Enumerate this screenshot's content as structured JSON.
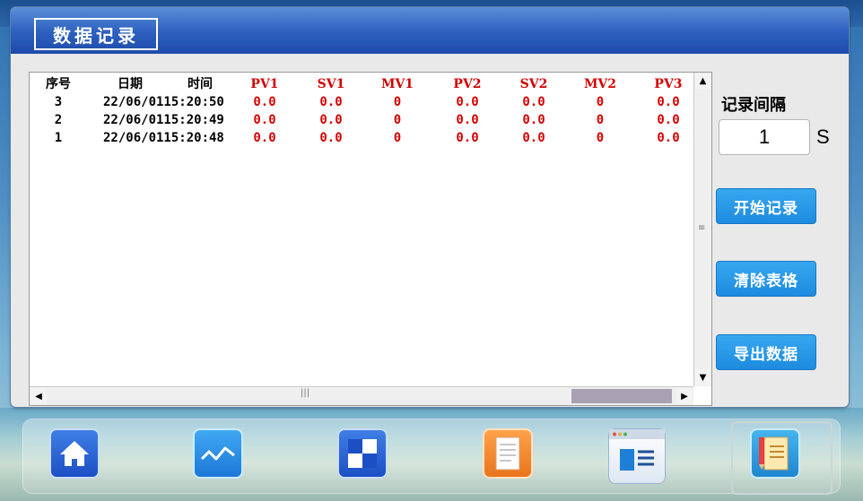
{
  "window": {
    "title": "数据记录"
  },
  "table": {
    "headers": {
      "seq": "序号",
      "date": "日期",
      "time": "时间",
      "pv1": "PV1",
      "sv1": "SV1",
      "mv1": "MV1",
      "pv2": "PV2",
      "sv2": "SV2",
      "mv2": "MV2",
      "pv3": "PV3"
    },
    "rows": [
      {
        "seq": "3",
        "datetime": "22/06/0115:20:50",
        "pv1": "0.0",
        "sv1": "0.0",
        "mv1": "0",
        "pv2": "0.0",
        "sv2": "0.0",
        "mv2": "0",
        "pv3": "0.0"
      },
      {
        "seq": "2",
        "datetime": "22/06/0115:20:49",
        "pv1": "0.0",
        "sv1": "0.0",
        "mv1": "0",
        "pv2": "0.0",
        "sv2": "0.0",
        "mv2": "0",
        "pv3": "0.0"
      },
      {
        "seq": "1",
        "datetime": "22/06/0115:20:48",
        "pv1": "0.0",
        "sv1": "0.0",
        "mv1": "0",
        "pv2": "0.0",
        "sv2": "0.0",
        "mv2": "0",
        "pv3": "0.0"
      }
    ]
  },
  "controls": {
    "interval_label": "记录间隔",
    "interval_value": "1",
    "interval_unit": "S",
    "start_label": "开始记录",
    "clear_label": "清除表格",
    "export_label": "导出数据"
  },
  "dock": {
    "icons": [
      "home-icon",
      "trend-icon",
      "grid-icon",
      "document-icon",
      "list-window-icon",
      "edit-document-icon"
    ]
  },
  "colors": {
    "titlebar": "#2c5fbf",
    "button": "#1d8bdf",
    "value_red": "#d40000"
  }
}
